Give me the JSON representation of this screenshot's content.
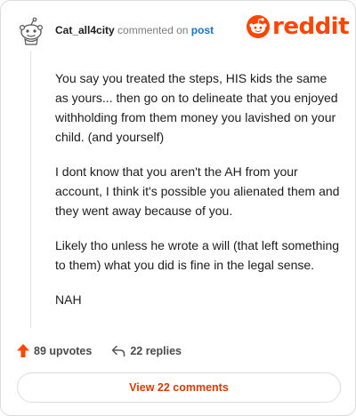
{
  "header": {
    "username": "Cat_all4city",
    "commented_on": "commented on",
    "post_link": "post"
  },
  "logo": {
    "wordmark": "reddit",
    "brand_color": "#ff4500"
  },
  "comment": {
    "paragraphs": [
      "You say you treated the steps, HIS kids the same as yours... then go on to delineate that you enjoyed withholding from them money you lavished on your child. (and yourself)",
      "I dont know that you aren't the AH from your account, I think it's possible you alienated them and they went away because of you.",
      "Likely tho unless he wrote a will (that left something to them) what you did is fine in the legal sense.",
      "NAH"
    ]
  },
  "footer": {
    "upvotes": "89 upvotes",
    "replies": "22 replies",
    "upvote_icon": "upvote-arrow-icon",
    "reply_icon": "reply-arrow-icon",
    "upvote_color": "#ff4500"
  },
  "view_button": {
    "label": "View 22 comments",
    "color": "#d93a00"
  }
}
